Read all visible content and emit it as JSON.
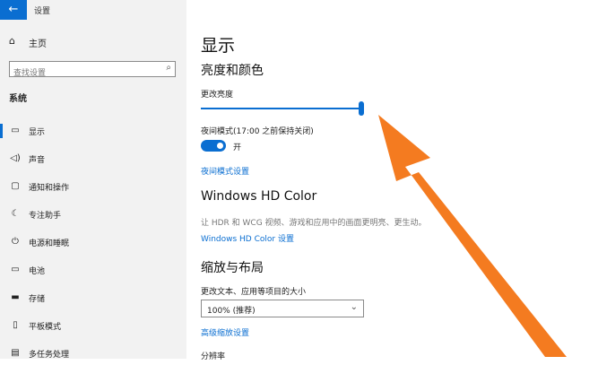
{
  "window": {
    "app_title": "设置",
    "back_glyph": "←"
  },
  "sidebar": {
    "home_label": "主页",
    "search_placeholder": "查找设置",
    "section": "系统",
    "items": [
      {
        "label": "显示",
        "icon": "monitor-icon",
        "active": true
      },
      {
        "label": "声音",
        "icon": "speaker-icon"
      },
      {
        "label": "通知和操作",
        "icon": "notification-icon"
      },
      {
        "label": "专注助手",
        "icon": "moon-icon"
      },
      {
        "label": "电源和睡眠",
        "icon": "power-icon"
      },
      {
        "label": "电池",
        "icon": "battery-icon"
      },
      {
        "label": "存储",
        "icon": "storage-icon"
      },
      {
        "label": "平板模式",
        "icon": "tablet-icon"
      },
      {
        "label": "多任务处理",
        "icon": "multitask-icon"
      }
    ]
  },
  "main": {
    "title": "显示",
    "brightness_color_heading": "亮度和颜色",
    "brightness_label": "更改亮度",
    "brightness_value_percent": 100,
    "night_light_label": "夜间模式(17:00 之前保持关闭)",
    "night_light_state": "开",
    "night_light_link": "夜间模式设置",
    "hd_color_heading": "Windows HD Color",
    "hd_color_desc": "让 HDR 和 WCG 视频、游戏和应用中的画面更明亮、更生动。",
    "hd_color_link": "Windows HD Color 设置",
    "scale_heading": "缩放与布局",
    "scale_label": "更改文本、应用等项目的大小",
    "scale_value": "100% (推荐)",
    "scale_link": "高级缩放设置",
    "resolution_label": "分辨率"
  },
  "colors": {
    "accent": "#0a6ed1",
    "annotation_arrow": "#f47b20"
  }
}
